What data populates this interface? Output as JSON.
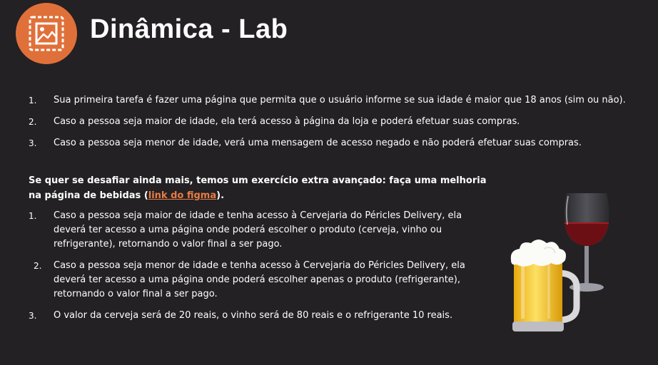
{
  "header": {
    "icon": "framed-picture-icon",
    "title": "Dinâmica - Lab"
  },
  "tasks": [
    {
      "num": "1.",
      "text": "Sua primeira tarefa é fazer uma página que permita que o usuário informe se sua idade é maior que 18 anos (sim ou não)."
    },
    {
      "num": "2.",
      "text": "Caso a pessoa seja maior de idade, ela terá acesso à página da loja e poderá efetuar suas compras."
    },
    {
      "num": "3.",
      "text": "Caso a pessoa seja menor de idade, verá uma mensagem de acesso negado e não poderá efetuar suas compras."
    }
  ],
  "challenge": {
    "text_before": "Se quer se desafiar ainda mais, temos um exercício extra avançado: faça uma melhoria na página de bebidas (",
    "link_text": "link do figma",
    "text_after": ")."
  },
  "extra_tasks": [
    {
      "num": "1.",
      "text": "Caso a pessoa seja maior de idade e tenha acesso à Cervejaria do Péricles Delivery, ela deverá ter acesso a uma página onde poderá escolher o produto (cerveja, vinho ou refrigerante), retornando o valor final a ser pago."
    },
    {
      "num": "2.",
      "text": "Caso a pessoa seja menor de idade e tenha acesso à Cervejaria do Péricles Delivery, ela deverá ter acesso a uma página onde poderá escolher apenas o produto (refrigerante), retornando o valor final a ser pago."
    },
    {
      "num": "3.",
      "text": "O valor da cerveja será de 20 reais, o vinho será de 80 reais e o refrigerante 10 reais."
    }
  ],
  "illustration": {
    "icons": [
      "beer-mug-icon",
      "wine-glass-icon"
    ]
  },
  "colors": {
    "background": "#232123",
    "accent": "#e0703a",
    "link": "#e87c46",
    "text": "#ffffff"
  }
}
